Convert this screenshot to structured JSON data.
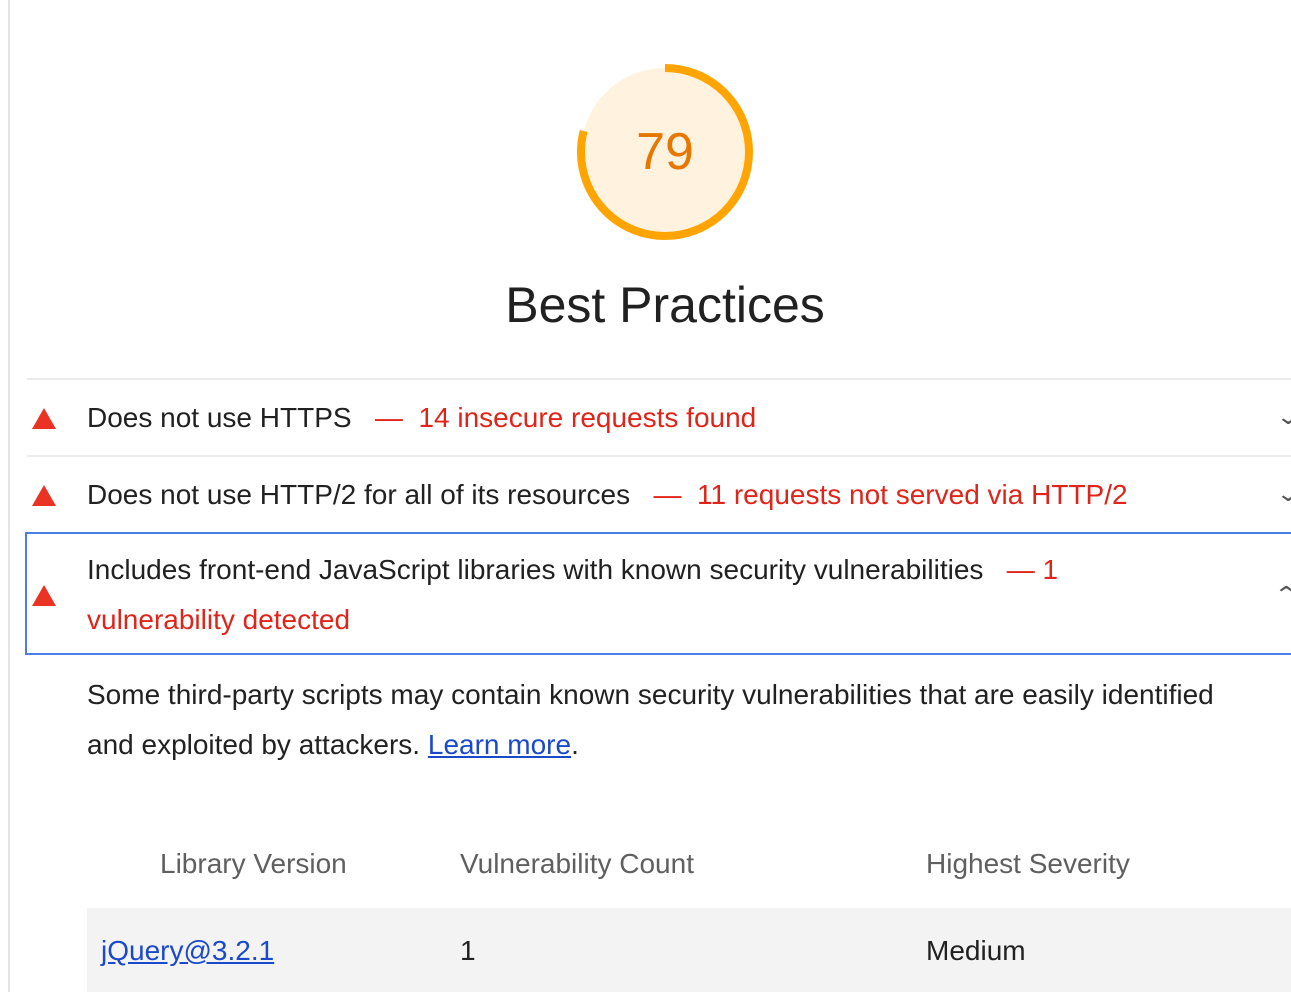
{
  "score": {
    "value": "79",
    "fraction": 0.79,
    "ring_color": "#ffa400",
    "fill_color": "#fff3e0",
    "text_color": "#e67700"
  },
  "category": {
    "title": "Best Practices"
  },
  "audits": [
    {
      "title": "Does not use HTTPS",
      "separator": "—",
      "display_value": "14 insecure requests found",
      "status": "fail",
      "expanded": false,
      "icon": "warning-triangle-icon"
    },
    {
      "title": "Does not use HTTP/2 for all of its resources",
      "separator": "—",
      "display_value": "11 requests not served via HTTP/2",
      "status": "fail",
      "expanded": false,
      "icon": "warning-triangle-icon"
    },
    {
      "title": "Includes front-end JavaScript libraries with known security vulnerabilities",
      "separator": "—",
      "display_value": "1 vulnerability detected",
      "status": "fail",
      "expanded": true,
      "icon": "warning-triangle-icon"
    }
  ],
  "details": {
    "description": "Some third-party scripts may contain known security vulnerabilities that are easily identified and exploited by attackers.",
    "learn_more": "Learn more",
    "end_punct": "."
  },
  "table": {
    "headers": [
      "Library Version",
      "Vulnerability Count",
      "Highest Severity"
    ],
    "rows": [
      {
        "library": "jQuery@3.2.1",
        "count": "1",
        "severity": "Medium"
      }
    ]
  },
  "colors": {
    "fail": "#eb3323",
    "fail_text": "#e0241a",
    "focus_border": "#4a7ee3",
    "link": "#1a49c9"
  }
}
